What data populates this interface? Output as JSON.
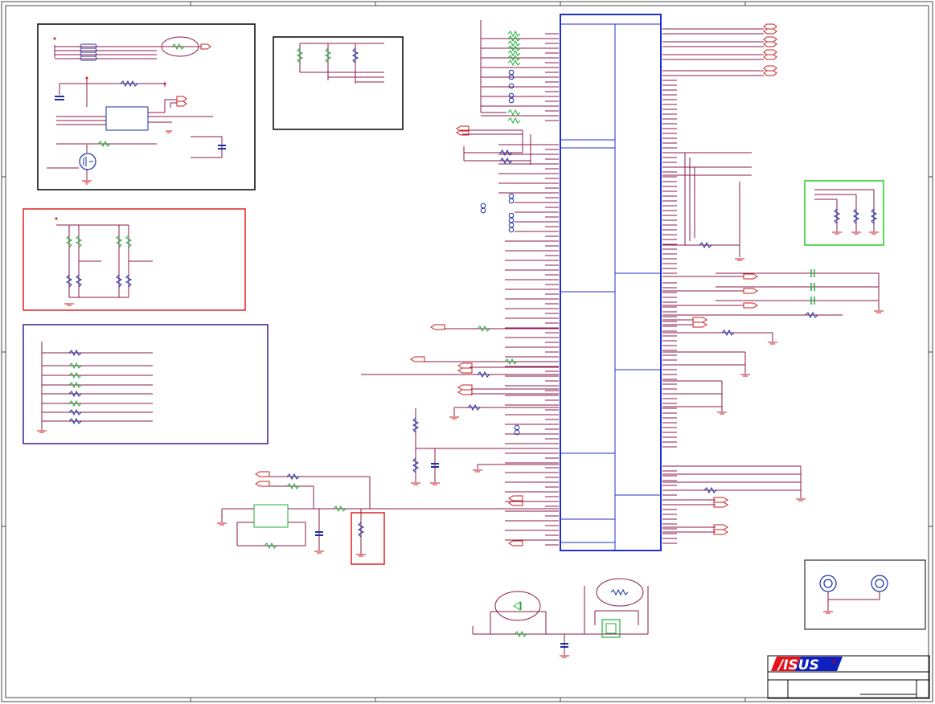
{
  "title_block": {
    "logo_text": "/ISUS",
    "registered_mark": "®",
    "logo_colors": [
      "#e8101a",
      "#1020c0",
      "#ffffff"
    ]
  },
  "colors": {
    "wire": "#8b1a4a",
    "power": "#c81e1e",
    "resistor": "#1a2ea8",
    "inductor": "#1fae3a",
    "outline_blue": "#2030d0",
    "outline_red": "#e02020",
    "outline_green": "#20d020",
    "outline_purple": "#3a1e8c",
    "border": "#444444"
  }
}
